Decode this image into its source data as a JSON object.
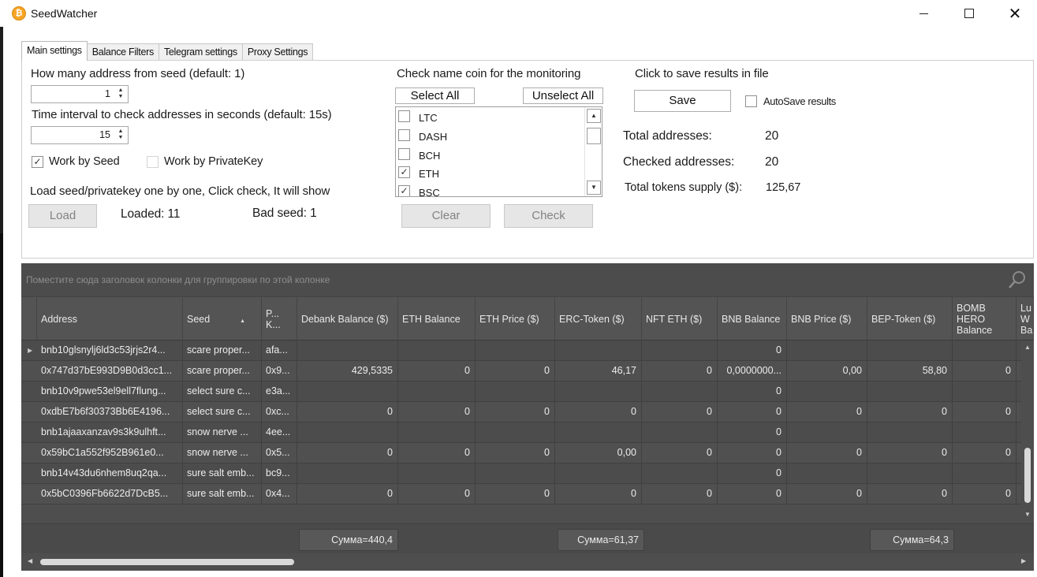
{
  "window": {
    "title": "SeedWatcher",
    "app_icon": "bitcoin-icon",
    "min_glyph": "—",
    "close_glyph": "✕"
  },
  "tabs": [
    "Main settings",
    "Balance Filters",
    "Telegram settings",
    "Proxy Settings"
  ],
  "settings": {
    "address_count_label": "How many address from seed (default: 1)",
    "address_count_value": "1",
    "interval_label": "Time interval to check addresses in seconds (default: 15s)",
    "interval_value": "15",
    "work_by_seed_label": "Work by Seed",
    "work_by_privatekey_label": "Work by PrivateKey",
    "load_hint": "Load seed/privatekey one by one, Click check, It will show",
    "load_button": "Load",
    "loaded_text": "Loaded: 11",
    "bad_seed_text": "Bad seed: 1",
    "spin_up": "▲",
    "spin_down": "▼",
    "checkmark": "✓"
  },
  "coins": {
    "title": "Check name coin for the monitoring",
    "select_all": "Select All",
    "unselect_all": "Unselect All",
    "items": [
      {
        "name": "LTC",
        "checked": false
      },
      {
        "name": "DASH",
        "checked": false
      },
      {
        "name": "BCH",
        "checked": false
      },
      {
        "name": "ETH",
        "checked": true
      },
      {
        "name": "BSC",
        "checked": true
      }
    ],
    "clear_button": "Clear",
    "check_button": "Check"
  },
  "results": {
    "save_label": "Click to save results in file",
    "save_button": "Save",
    "autosave_label": "AutoSave results",
    "total_addresses_label": "Total addresses:",
    "total_addresses_value": "20",
    "checked_addresses_label": "Checked addresses:",
    "checked_addresses_value": "20",
    "total_tokens_label": "Total tokens supply ($):",
    "total_tokens_value": "125,67"
  },
  "grid": {
    "group_hint": "Поместите сюда заголовок колонки для группировки по этой колонке",
    "columns": [
      "Address",
      "Seed",
      "P... K...",
      "Debank Balance ($)",
      "ETH Balance",
      "ETH Price ($)",
      "ERC-Token ($)",
      "NFT ETH ($)",
      "BNB Balance",
      "BNB Price ($)",
      "BEP-Token ($)",
      "BOMB HERO Balance",
      "Lu W Ba"
    ],
    "rows": [
      [
        "bnb10glsnylj6ld3c53jrjs2r4...",
        "scare proper...",
        "afa...",
        "",
        "",
        "",
        "",
        "",
        "0",
        "",
        "",
        "",
        ""
      ],
      [
        "0x747d37bE993D9B0d3cc1...",
        "scare proper...",
        "0x9...",
        "429,5335",
        "0",
        "0",
        "46,17",
        "0",
        "0,0000000...",
        "0,00",
        "58,80",
        "0",
        ""
      ],
      [
        "bnb10v9pwe53el9ell7flung...",
        "select sure c...",
        "e3a...",
        "",
        "",
        "",
        "",
        "",
        "0",
        "",
        "",
        "",
        ""
      ],
      [
        "0xdbE7b6f30373Bb6E4196...",
        "select sure c...",
        "0xc...",
        "0",
        "0",
        "0",
        "0",
        "0",
        "0",
        "0",
        "0",
        "0",
        ""
      ],
      [
        "bnb1ajaaxanzav9s3k9ulhft...",
        "snow nerve ...",
        "4ee...",
        "",
        "",
        "",
        "",
        "",
        "0",
        "",
        "",
        "",
        ""
      ],
      [
        "0x59bC1a552f952B961e0...",
        "snow nerve ...",
        "0x5...",
        "0",
        "0",
        "0",
        "0,00",
        "0",
        "0",
        "0",
        "0",
        "0",
        ""
      ],
      [
        "bnb14v43du6nhem8uq2qa...",
        "sure salt emb...",
        "bc9...",
        "",
        "",
        "",
        "",
        "",
        "0",
        "",
        "",
        "",
        ""
      ],
      [
        "0x5bC0396Fb6622d7DcB5...",
        "sure salt emb...",
        "0x4...",
        "0",
        "0",
        "0",
        "0",
        "0",
        "0",
        "0",
        "0",
        "0",
        ""
      ]
    ],
    "sums": {
      "debank": "Сумма=440,4",
      "erc": "Сумма=61,37",
      "bep": "Сумма=64,3"
    }
  }
}
